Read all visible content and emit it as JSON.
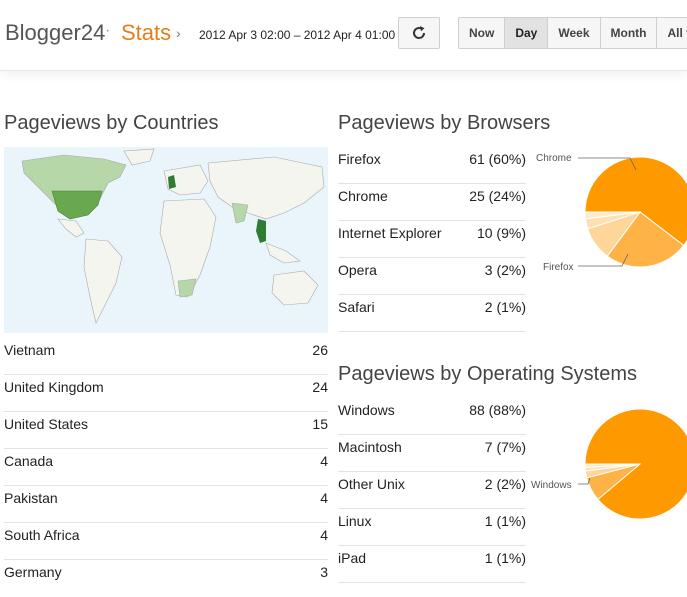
{
  "header": {
    "brand": "Blogger24",
    "separator": "·",
    "section": "Stats",
    "crumb_arrow": "›",
    "date_range": "2012 Apr 3 02:00 – 2012 Apr 4 01:00",
    "ranges": [
      "Now",
      "Day",
      "Week",
      "Month",
      "All ti"
    ],
    "active_range": "Day"
  },
  "countries": {
    "title": "Pageviews by Countries",
    "rows": [
      {
        "name": "Vietnam",
        "value": "26"
      },
      {
        "name": "United Kingdom",
        "value": "24"
      },
      {
        "name": "United States",
        "value": "15"
      },
      {
        "name": "Canada",
        "value": "4"
      },
      {
        "name": "Pakistan",
        "value": "4"
      },
      {
        "name": "South Africa",
        "value": "4"
      },
      {
        "name": "Germany",
        "value": "3"
      }
    ]
  },
  "browsers": {
    "title": "Pageviews by Browsers",
    "rows": [
      {
        "name": "Firefox",
        "value": "61 (60%)"
      },
      {
        "name": "Chrome",
        "value": "25 (24%)"
      },
      {
        "name": "Internet Explorer",
        "value": "10 (9%)"
      },
      {
        "name": "Opera",
        "value": "3 (2%)"
      },
      {
        "name": "Safari",
        "value": "2 (1%)"
      }
    ],
    "pie_labels": [
      "Chrome",
      "Firefox"
    ]
  },
  "os": {
    "title": "Pageviews by Operating Systems",
    "rows": [
      {
        "name": "Windows",
        "value": "88 (88%)"
      },
      {
        "name": "Macintosh",
        "value": "7 (7%)"
      },
      {
        "name": "Other Unix",
        "value": "2 (2%)"
      },
      {
        "name": "Linux",
        "value": "1 (1%)"
      },
      {
        "name": "iPad",
        "value": "1 (1%)"
      }
    ],
    "pie_labels": [
      "Windows"
    ]
  },
  "colors": {
    "brand_text": "#555555",
    "section_text": "#e67c1a",
    "map_ocean": "#eaf4fb",
    "map_land": "#f5f5ef",
    "map_high": "#2f7d32",
    "map_mid": "#6aa84f",
    "map_low": "#b6d7a8",
    "pie_main": "#ff9900",
    "pie_second": "#ffb347",
    "pie_minor": "#ffd699"
  },
  "chart_data": [
    {
      "type": "pie",
      "labels": [
        "Firefox",
        "Chrome",
        "Internet Explorer",
        "Opera",
        "Safari"
      ],
      "values": [
        61,
        25,
        10,
        3,
        2
      ]
    },
    {
      "type": "pie",
      "labels": [
        "Windows",
        "Macintosh",
        "Other Unix",
        "Linux",
        "iPad"
      ],
      "values": [
        88,
        7,
        2,
        1,
        1
      ]
    }
  ]
}
